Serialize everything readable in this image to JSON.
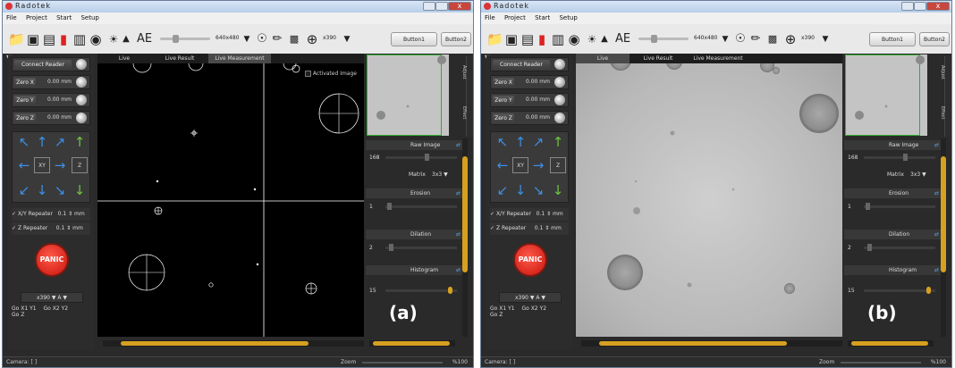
{
  "app": {
    "title": "Radotek",
    "close_glyph": "x"
  },
  "menu": [
    "File",
    "Project",
    "Start",
    "Setup"
  ],
  "toolbar": {
    "ae_label": "AE",
    "resolution": "640x480",
    "zoom": "x390",
    "button1": "Button1",
    "button2": "Button2"
  },
  "left": {
    "connect": "Connect Reader",
    "axes": [
      {
        "label": "Zero X",
        "value": "0.00",
        "unit": "mm"
      },
      {
        "label": "Zero Y",
        "value": "0.00",
        "unit": "mm"
      },
      {
        "label": "Zero Z",
        "value": "0.00",
        "unit": "mm"
      }
    ],
    "xy_label": "XY",
    "z_label": "Z",
    "xy_repeater": {
      "label": "X/Y Repeater",
      "value": "0.1",
      "unit": "mm"
    },
    "z_repeater": {
      "label": "Z Repeater",
      "value": "0.1",
      "unit": "mm"
    },
    "panic": "PANIC",
    "zoom_select": "x390",
    "zoom_select_sub": "A",
    "go_buttons": [
      "Go X1 Y1",
      "Go X2 Y2",
      "Go Z"
    ]
  },
  "tabs": [
    "Live",
    "Live Result",
    "Live Measurement"
  ],
  "view_a": {
    "activated_label": "Activated Image"
  },
  "right": {
    "raw_image": "Raw Image",
    "raw_value": "168",
    "matrix_label": "Matrix",
    "matrix_value": "3x3",
    "erosion": "Erosion",
    "erosion_value": "1",
    "dilation": "Dilation",
    "dilation_value": "2",
    "histogram": "Histogram",
    "histogram_value": "15",
    "side_tabs": [
      "Adjust",
      "Effect"
    ]
  },
  "status": {
    "camera": "Camera: [ ]",
    "zoom_label": "Zoom",
    "zoom_value": "%100"
  },
  "figure_labels": [
    "(a)",
    "(b)"
  ]
}
